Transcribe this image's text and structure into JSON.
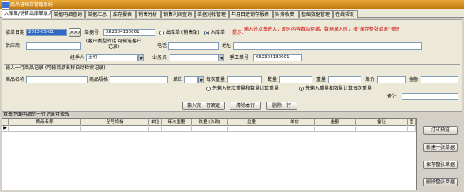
{
  "window": {
    "title": "商品进销存管理系统"
  },
  "tabs": [
    {
      "label": "入库单/销售出库单录入",
      "active": true
    },
    {
      "label": "单据明细查询"
    },
    {
      "label": "单据汇总"
    },
    {
      "label": "库存报表"
    },
    {
      "label": "销售分析"
    },
    {
      "label": "销售利润查询"
    },
    {
      "label": "单据对帐管理"
    },
    {
      "label": "年月日进销存报表"
    },
    {
      "label": "财务收支"
    },
    {
      "label": "基础数据管理"
    },
    {
      "label": "在线帮助"
    }
  ],
  "form": {
    "date_label": "填单日期",
    "date_value": "2013-05-01",
    "date_btn": ">>>",
    "docno_label": "单据号",
    "docno_value": "XR2304130001",
    "radio_out": "出库单 (销售单)",
    "radio_in": "入库单",
    "hint_label": "提示：",
    "hint_text": "输入并点击进入，即时内容自动存储，数据录入时，按\"保存整张单据\"按钮",
    "unit_label": "供应商",
    "unit_note": "(客户类型的话 可输送客户记录)",
    "phone_label": "电话",
    "addr_label": "地址",
    "handler_label": "经手人",
    "handler_value": "王明",
    "salesman_label": "业务员",
    "manual_label": "手工单号",
    "manual_value": "XR2304130001"
  },
  "entry": {
    "section_label": "输入一行商品记录 (可输商品名称自动检索记录)",
    "name_label": "商品名称",
    "spec_label": "商品规格",
    "unit_label": "单位",
    "per_weight_label": "每次重量",
    "qty_label": "数量",
    "weight_label": "重量",
    "price_label": "单价",
    "amount_label": "金额",
    "radio_a": "先输入每次重量和数量计算重量",
    "radio_b": "先输入重量和数量计算每次重量",
    "remark_label": "备注",
    "btn_confirm": "输入完一行确定",
    "btn_clear": "清除本行",
    "btn_delete": "删除一行"
  },
  "grid": {
    "caption": "双击下面明细的一行记录可修改",
    "columns": [
      "商品名称",
      "型号规格",
      "单位",
      "每次重量",
      "数量 (次数)",
      "重量",
      "单价",
      "金额",
      "备注",
      "图"
    ]
  },
  "side_buttons": {
    "print": "打印预览",
    "new": "新建一张单据",
    "save": "保存整张单据",
    "delete": "删除整张单据"
  }
}
